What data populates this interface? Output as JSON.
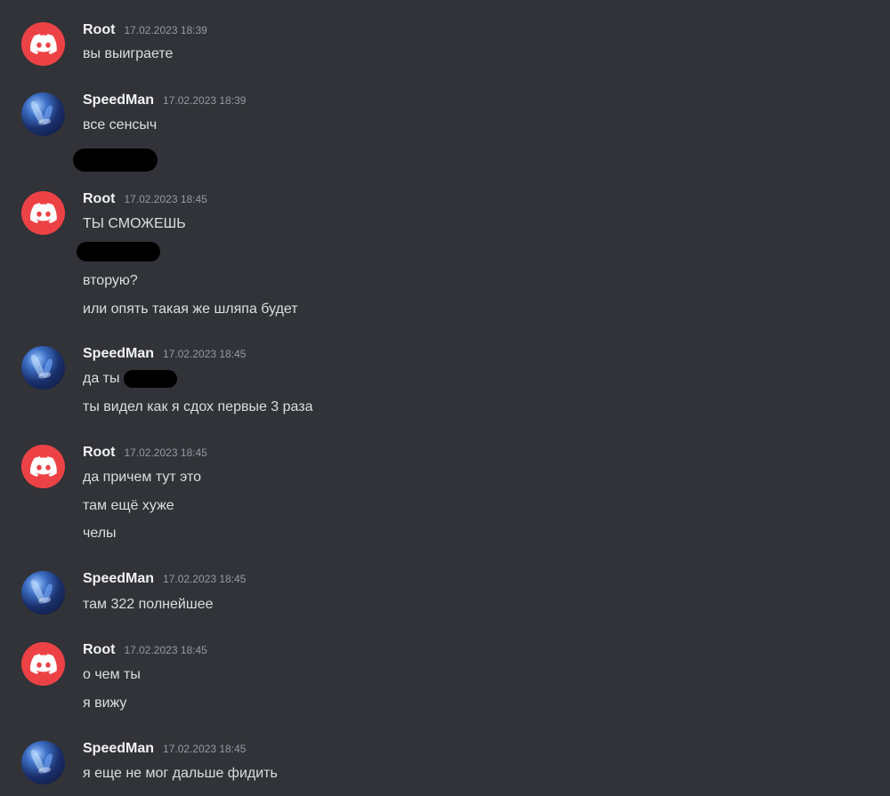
{
  "messages": [
    {
      "author": "Root",
      "timestamp": "17.02.2023 18:39",
      "lines": [
        "вы выиграете"
      ]
    },
    {
      "author": "SpeedMan",
      "timestamp": "17.02.2023 18:39",
      "lines": [
        "все сенсыч"
      ]
    },
    {
      "author": "Root",
      "timestamp": "17.02.2023 18:45",
      "lines": [
        "ТЫ СМОЖЕШЬ",
        "вторую?",
        "или опять такая же шляпа будет"
      ]
    },
    {
      "author": "SpeedMan",
      "timestamp": "17.02.2023 18:45",
      "lines": [
        "да ты",
        "ты видел как я сдох первые 3 раза"
      ]
    },
    {
      "author": "Root",
      "timestamp": "17.02.2023 18:45",
      "lines": [
        "да причем тут это",
        "там ещё хуже",
        "челы"
      ]
    },
    {
      "author": "SpeedMan",
      "timestamp": "17.02.2023 18:45",
      "lines": [
        "там 322 полнейшее"
      ]
    },
    {
      "author": "Root",
      "timestamp": "17.02.2023 18:45",
      "lines": [
        "о чем ты",
        "я вижу"
      ]
    },
    {
      "author": "SpeedMan",
      "timestamp": "17.02.2023 18:45",
      "lines": [
        "я еще не мог дальше фидить"
      ]
    }
  ],
  "avatars": {
    "root": {
      "icon": "discord-logo-icon",
      "color": "#ed4245"
    },
    "speedman": {
      "icon": "profile-picture"
    }
  }
}
